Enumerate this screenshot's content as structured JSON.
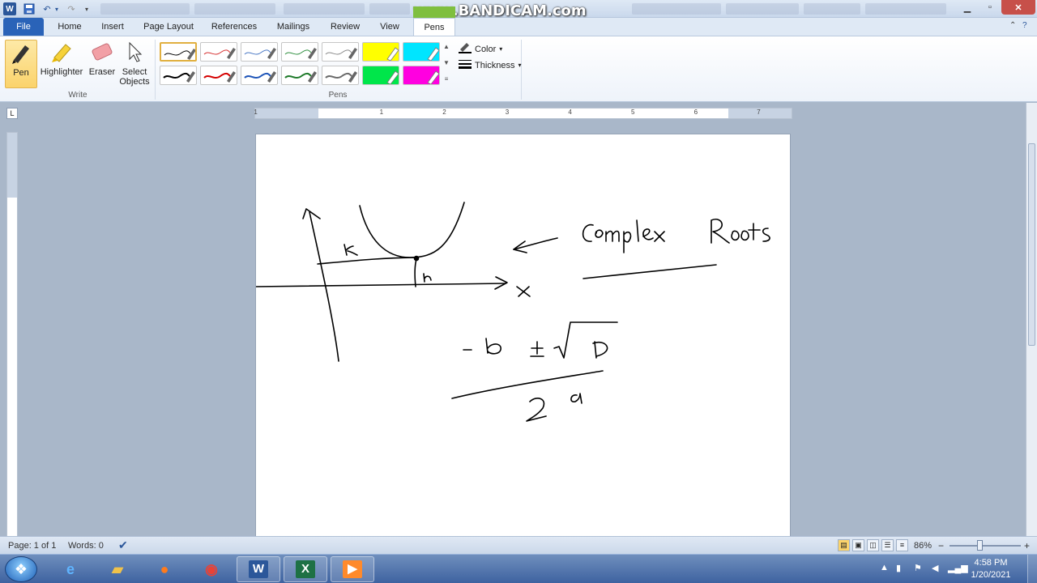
{
  "titlebar": {
    "watermark": "www.BANDICAM.com",
    "minimize_icon": "minimize-icon",
    "maximize_icon": "maximize-icon",
    "close_icon": "close-icon"
  },
  "tabs": {
    "file": "File",
    "home": "Home",
    "insert": "Insert",
    "page_layout": "Page Layout",
    "references": "References",
    "mailings": "Mailings",
    "review": "Review",
    "view": "View",
    "pens": "Pens"
  },
  "ribbon": {
    "write": {
      "pen": "Pen",
      "highlighter": "Highlighter",
      "eraser": "Eraser",
      "select_line1": "Select",
      "select_line2": "Objects",
      "group_label": "Write"
    },
    "pens": {
      "group_label": "Pens",
      "row1": [
        "#000000",
        "#d63030",
        "#4a78c4",
        "#2f8f3f",
        "#8a8a8a",
        "#ffff00",
        "#00e5ff"
      ],
      "row2": [
        "#000000",
        "#d40000",
        "#1f55b8",
        "#1f7a2a",
        "#6a6a6a",
        "#00e64a",
        "#ff00e0"
      ],
      "selected_index": 0
    },
    "color_label": "Color",
    "thickness_label": "Thickness"
  },
  "ruler": {
    "numbers": [
      "1",
      "1",
      "2",
      "3",
      "4",
      "5",
      "6",
      "7"
    ]
  },
  "status": {
    "page": "Page: 1 of 1",
    "words": "Words: 0",
    "zoom": "86%",
    "zoom_minus": "−",
    "zoom_plus": "+"
  },
  "taskbar": {
    "time": "4:58 PM",
    "date": "1/20/2021",
    "apps": [
      "internet-explorer",
      "windows-explorer",
      "firefox",
      "chrome",
      "word",
      "excel",
      "bandicam"
    ],
    "word_glyph": "W",
    "excel_glyph": "X",
    "bandicam_glyph": "▶"
  }
}
